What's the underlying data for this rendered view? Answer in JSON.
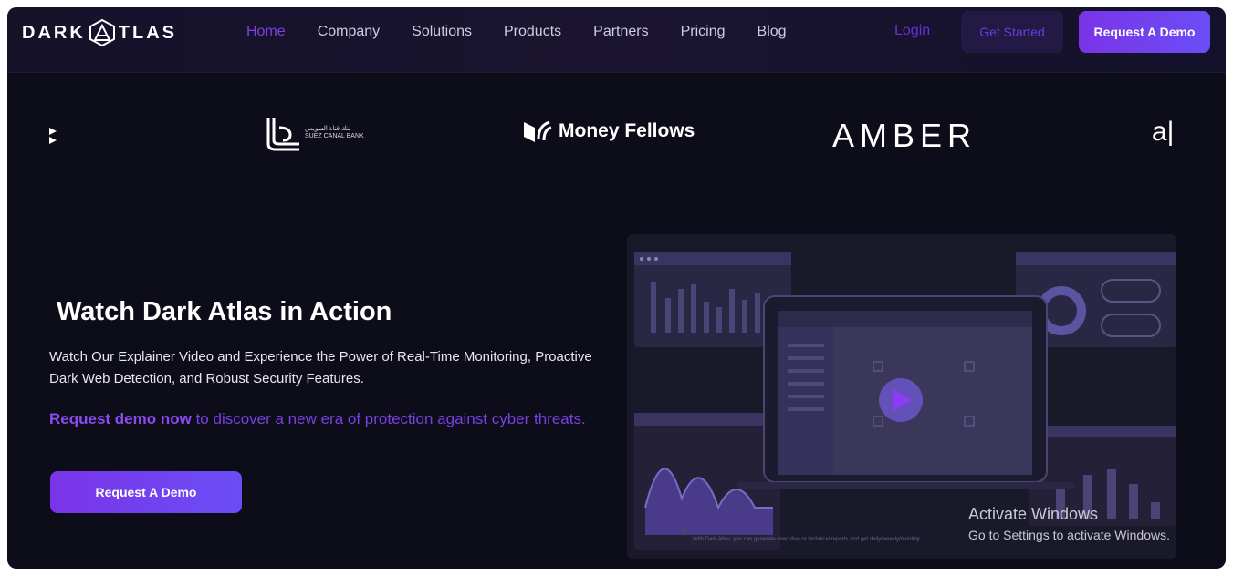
{
  "brand": {
    "logo_text_left": "DARK",
    "logo_text_right": "TLAS",
    "logo_mark": "A"
  },
  "nav": {
    "links": [
      "Home",
      "Company",
      "Solutions",
      "Products",
      "Partners",
      "Pricing",
      "Blog"
    ],
    "login": "Login",
    "get_started": "Get Started",
    "request_demo": "Request A Demo"
  },
  "partners": {
    "bank_line1": "بنك قناة السويس",
    "bank_line2": "SUEZ CANAL BANK",
    "money_fellows": "Money Fellows",
    "amber": "AMBER",
    "partial": "a|"
  },
  "hero": {
    "title": "Watch Dark Atlas in Action",
    "subtitle": "Watch Our Explainer Video and Experience the Power of Real-Time Monitoring, Proactive Dark Web Detection, and Robust Security Features.",
    "cta_bold": "Request demo now",
    "cta_rest": " to discover a new era of protection against cyber threats.",
    "button": "Request A Demo"
  },
  "video": {
    "caption": "With Dark Atlas, you can generate executive or technical reports and get daily/weekly/monthly"
  },
  "watermark": {
    "line1": "Activate Windows",
    "line2": "Go to Settings to activate Windows."
  },
  "colors": {
    "accent": "#7b3fe4",
    "background": "#0d0c19",
    "nav_bg": "#16122a"
  },
  "icons": [
    "play-icon",
    "money-fellows-icon",
    "suez-bank-icon",
    "dark-atlas-logo-icon"
  ]
}
